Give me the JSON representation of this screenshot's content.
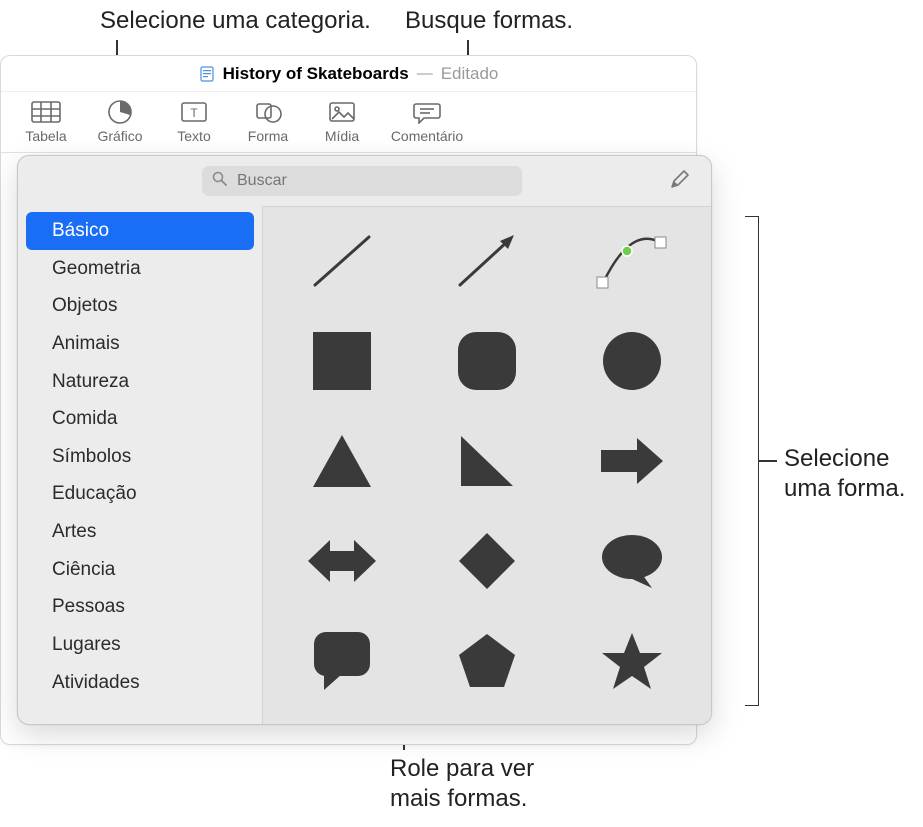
{
  "annotations": {
    "select_category": "Selecione uma categoria.",
    "search_shapes": "Busque formas.",
    "select_shape_line1": "Selecione",
    "select_shape_line2": "uma forma.",
    "scroll_more_line1": "Role para ver",
    "scroll_more_line2": "mais formas."
  },
  "titlebar": {
    "document_name": "History of Skateboards",
    "separator": "—",
    "status": "Editado"
  },
  "toolbar": {
    "table": "Tabela",
    "chart": "Gráfico",
    "text": "Texto",
    "shape": "Forma",
    "media": "Mídia",
    "comment": "Comentário"
  },
  "search": {
    "placeholder": "Buscar",
    "value": ""
  },
  "sidebar": {
    "items": [
      {
        "label": "Básico",
        "selected": true
      },
      {
        "label": "Geometria"
      },
      {
        "label": "Objetos"
      },
      {
        "label": "Animais"
      },
      {
        "label": "Natureza"
      },
      {
        "label": "Comida"
      },
      {
        "label": "Símbolos"
      },
      {
        "label": "Educação"
      },
      {
        "label": "Artes"
      },
      {
        "label": "Ciência"
      },
      {
        "label": "Pessoas"
      },
      {
        "label": "Lugares"
      },
      {
        "label": "Atividades"
      }
    ]
  },
  "shapes": {
    "items": [
      {
        "name": "line"
      },
      {
        "name": "arrow-line"
      },
      {
        "name": "curve"
      },
      {
        "name": "square"
      },
      {
        "name": "rounded-square"
      },
      {
        "name": "circle"
      },
      {
        "name": "triangle"
      },
      {
        "name": "right-triangle"
      },
      {
        "name": "arrow-right"
      },
      {
        "name": "arrow-double"
      },
      {
        "name": "diamond"
      },
      {
        "name": "speech-oval"
      },
      {
        "name": "speech-square"
      },
      {
        "name": "pentagon"
      },
      {
        "name": "star"
      }
    ]
  },
  "colors": {
    "shape_fill": "#3a3a3a",
    "accent": "#1a6ef5"
  }
}
